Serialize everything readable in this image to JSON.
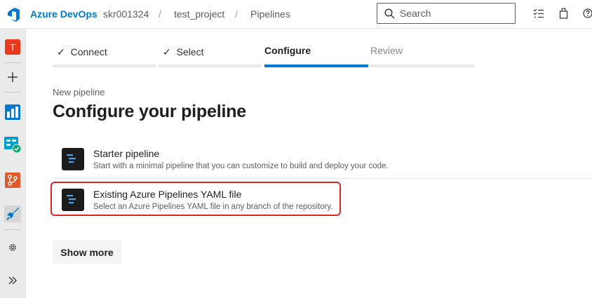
{
  "header": {
    "brand": "Azure DevOps",
    "breadcrumbs": [
      "skr001324",
      "test_project",
      "Pipelines"
    ],
    "separator": "/",
    "search": {
      "placeholder": "Search",
      "value": ""
    },
    "icons": [
      "checklist-icon",
      "shopping-bag-icon",
      "help-icon"
    ]
  },
  "leftnav": {
    "avatar_letter": "T",
    "items": [
      "new-icon",
      "boards-icon",
      "test-plans-icon",
      "repos-icon",
      "pipelines-icon",
      "settings-icon",
      "expand-icon"
    ],
    "colors": {
      "avatar": "#e8391f",
      "boards": "#0078d4",
      "test": "#009ccc",
      "repos": "#e05a2b"
    }
  },
  "wizard": {
    "steps": [
      {
        "label": "Connect",
        "state": "done"
      },
      {
        "label": "Select",
        "state": "done"
      },
      {
        "label": "Configure",
        "state": "active"
      },
      {
        "label": "Review",
        "state": "pending"
      }
    ],
    "check_glyph": "✓"
  },
  "main": {
    "subtitle": "New pipeline",
    "title": "Configure your pipeline",
    "options": [
      {
        "title": "Starter pipeline",
        "description": "Start with a minimal pipeline that you can customize to build and deploy your code."
      },
      {
        "title": "Existing Azure Pipelines YAML file",
        "description": "Select an Azure Pipelines YAML file in any branch of the repository."
      }
    ],
    "show_more": "Show more",
    "highlight_color": "#d9232d",
    "accent": "#0078d4"
  }
}
